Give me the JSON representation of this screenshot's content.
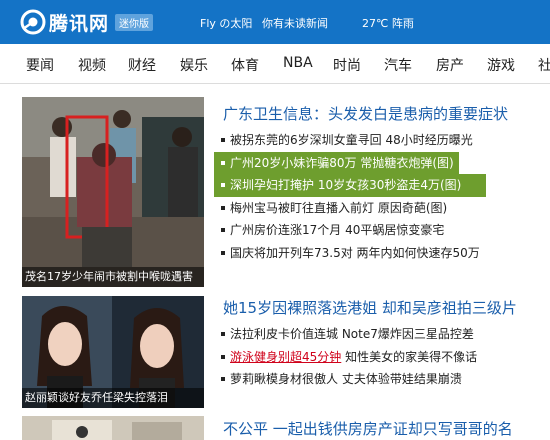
{
  "header": {
    "logo_text": "腾讯网",
    "mini_badge": "迷你版",
    "user": "Fly の太阳",
    "messages": "你有未读新闻",
    "weather": "27℃ 阵雨"
  },
  "nav": {
    "items": [
      "要闻",
      "视频",
      "财经",
      "娱乐",
      "体育",
      "NBA",
      "时尚",
      "汽车",
      "房产",
      "游戏",
      "社"
    ]
  },
  "sections": [
    {
      "thumb_caption": "茂名17岁少年闹市被割中喉咙遇害",
      "headline": "广东卫生信息：头发发白是患病的重要症状",
      "items": [
        "被拐东莞的6岁深圳女童寻回 48小时经历曝光",
        "广州20岁小妹诈骗80万 常抛糖衣炮弹(图)",
        "深圳孕妇打掩护 10岁女孩30秒盗走4万(图)",
        "梅州宝马被盯往直播入前灯 原因奇葩(图)",
        "广州房价连涨17个月 40平蜗居惊变豪宅",
        "国庆将加开列车73.5对 两年内如何快速存50万"
      ]
    },
    {
      "thumb_caption": "赵丽颖谈好友乔任梁失控落泪",
      "headline": "她15岁因裸照落选港姐 却和吴彦祖拍三级片",
      "items": [
        "法拉利皮卡价值连城 Note7爆炸因三星品控差",
        "知性美女的家美得不像话",
        "萝莉瞅模身材很傲人 丈夫体验带娃结果崩溃"
      ],
      "highlight": "游泳健身别超45分钟"
    },
    {
      "headline": "不公平 一起出钱供房房产证却只写哥哥的名"
    }
  ],
  "colors": {
    "topbar": "#1473c6",
    "headline": "#1a5eab",
    "selected": "#6e9e2e",
    "highlight": "#d0021b"
  }
}
